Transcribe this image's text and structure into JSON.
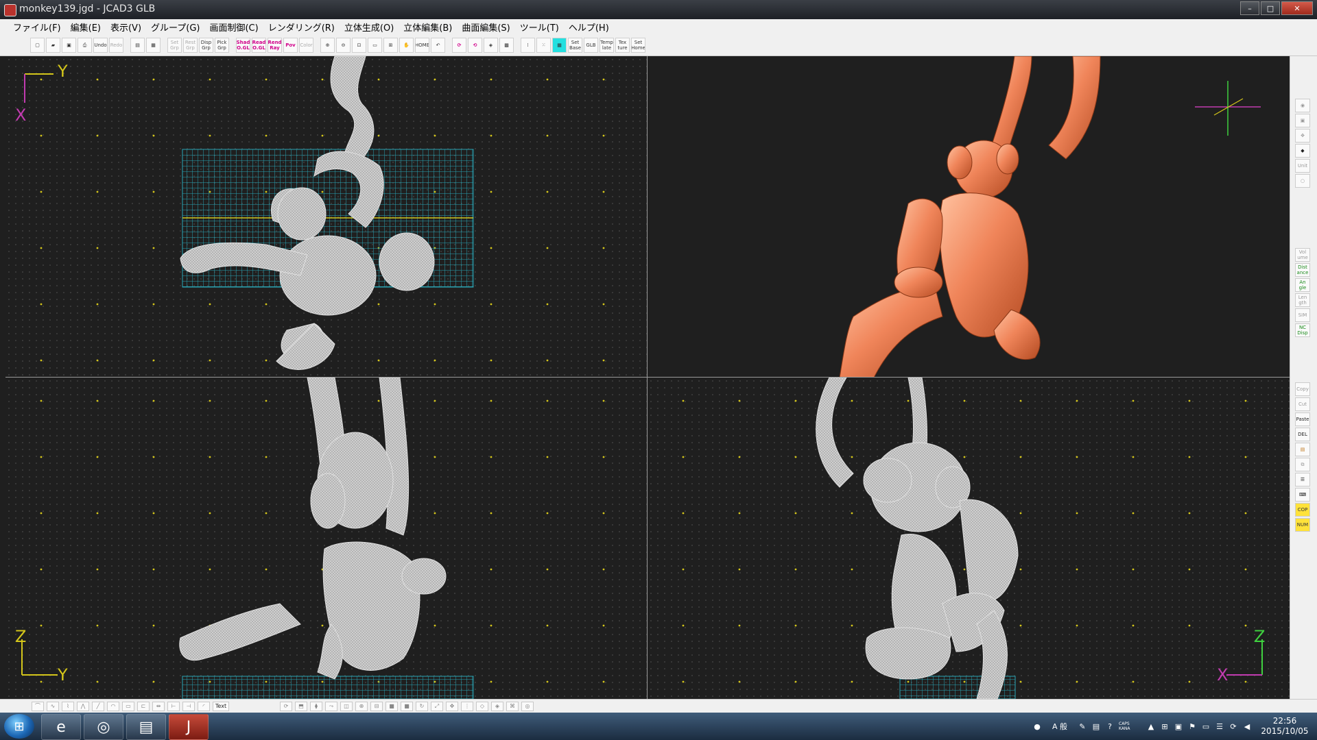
{
  "window": {
    "title": "monkey139.jgd - JCAD3 GLB",
    "controls": {
      "minimize": "–",
      "maximize": "□",
      "close": "✕"
    }
  },
  "menu": [
    "ファイル(F)",
    "編集(E)",
    "表示(V)",
    "グループ(G)",
    "画面制御(C)",
    "レンダリング(R)",
    "立体生成(O)",
    "立体編集(B)",
    "曲面編集(S)",
    "ツール(T)",
    "ヘルプ(H)"
  ],
  "toolbar": {
    "undo": "Undo",
    "redo": "Redo",
    "set_grp": "Set Grp",
    "reset_grp": "Rest Grp",
    "disp_grp": "Disp Grp",
    "pick_grp": "Pick Grp",
    "shad": "Shad O.GL",
    "read_ogl": "Read O.GL",
    "rend_ray": "Rend Ray",
    "pov": "Pov",
    "color": "Color",
    "home": "HOME",
    "set_base": "Set Base",
    "glb": "GLB",
    "template": "Temp late",
    "texture": "Tex ture",
    "set_home": "Set Home"
  },
  "viewports": {
    "top_left": {
      "axis_h": "Y",
      "axis_v": "X"
    },
    "bottom_left": {
      "axis_h": "Y",
      "axis_v": "Z"
    },
    "bottom_right": {
      "axis_h": "X",
      "axis_v": "Z"
    }
  },
  "palette": {
    "unit": "Unit",
    "volume": "Vol ume",
    "distance": "Dist ance",
    "angle": "An gle",
    "length": "Len gth",
    "sim": "SIM",
    "nc_disp": "NC Disp",
    "copy": "Copy",
    "cut": "Cut",
    "paste": "Paste",
    "del": "DEL",
    "cop": "COP",
    "num": "NUM"
  },
  "bottombar": {
    "text_btn": "Text"
  },
  "taskbar": {
    "start": "⊞",
    "apps": [
      "e",
      "◎",
      "▤",
      "J"
    ],
    "tray": {
      "ime": "A 般",
      "caps": "CAPS KANA"
    },
    "clock": {
      "time": "22:56",
      "date": "2015/10/05"
    }
  },
  "colors": {
    "viewport_bg": "#1f1f1f",
    "grid_cyan": "#2aa6b5",
    "axis_yellow": "#d4c61a",
    "axis_magenta": "#c23bb0",
    "axis_green": "#3fd13f",
    "wire_white": "#d8d8d8",
    "model_orange": "#f0855a"
  }
}
